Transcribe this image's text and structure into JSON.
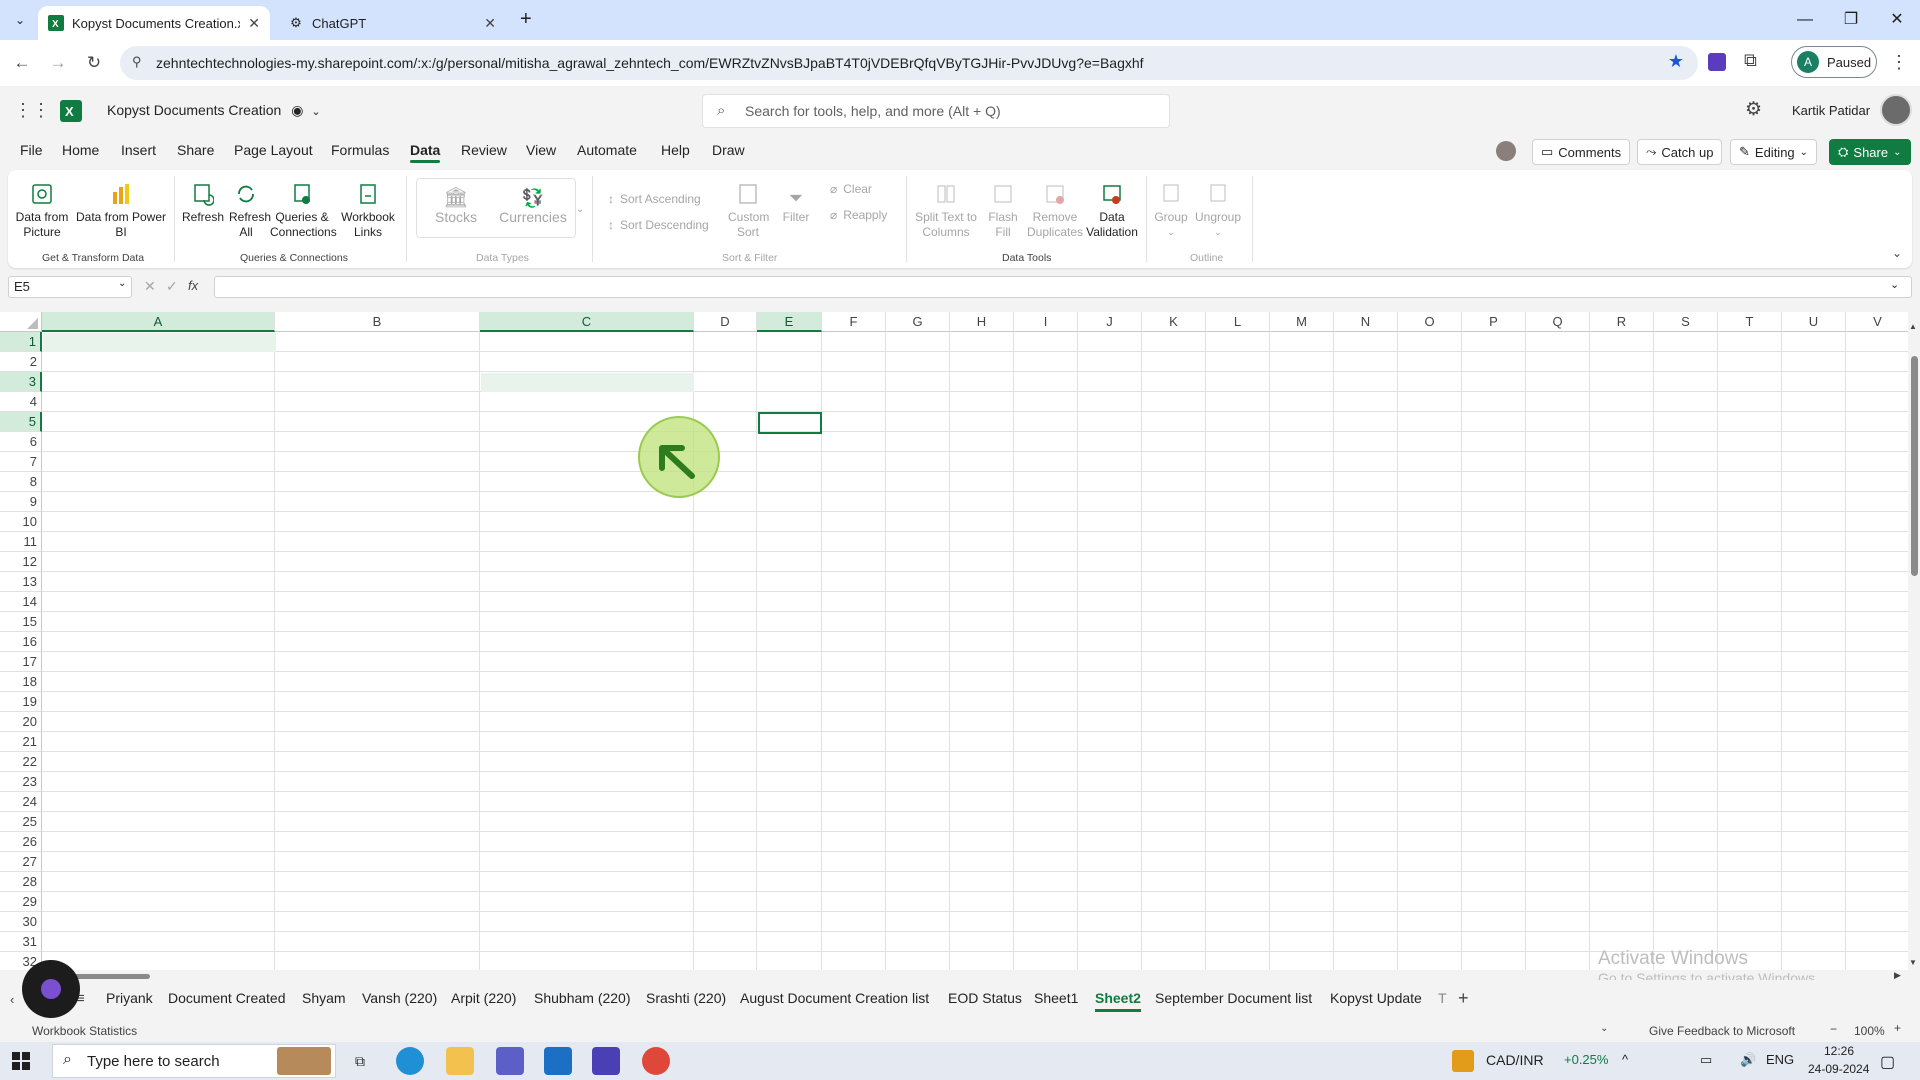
{
  "browser": {
    "tabs": [
      {
        "title": "Kopyst Documents Creation.xlsx",
        "active": true
      },
      {
        "title": "ChatGPT",
        "active": false
      }
    ],
    "url": "zehntechtechnologies-my.sharepoint.com/:x:/g/personal/mitisha_agrawal_zehntech_com/EWRZtvZNvsBJpaBT4T0jVDEBrQfqVByTGJHir-PvvJDUvg?e=Bagxhf",
    "profile_initial": "A",
    "profile_status": "Paused"
  },
  "app": {
    "title": "Kopyst Documents Creation",
    "search_placeholder": "Search for tools, help, and more (Alt + Q)",
    "user_name": "Kartik Patidar"
  },
  "menu": {
    "items": [
      "File",
      "Home",
      "Insert",
      "Share",
      "Page Layout",
      "Formulas",
      "Data",
      "Review",
      "View",
      "Automate",
      "Help",
      "Draw"
    ],
    "selected": "Data",
    "comments": "Comments",
    "catchup": "Catch up",
    "editing": "Editing",
    "share": "Share"
  },
  "ribbon": {
    "data_from_picture": "Data from Picture",
    "data_from_powerbi": "Data from Power BI",
    "refresh": "Refresh",
    "refresh_all": "Refresh All",
    "queries": "Queries & Connections",
    "workbook_links": "Workbook Links",
    "stocks": "Stocks",
    "currencies": "Currencies",
    "sort_asc": "Sort Ascending",
    "sort_desc": "Sort Descending",
    "custom_sort": "Custom Sort",
    "filter": "Filter",
    "clear": "Clear",
    "reapply": "Reapply",
    "split_text": "Split Text to Columns",
    "flash_fill": "Flash Fill",
    "remove_dupes": "Remove Duplicates",
    "data_validation": "Data Validation",
    "group": "Group",
    "ungroup": "Ungroup",
    "groups": {
      "get_transform": "Get & Transform Data",
      "queries_connections": "Queries & Connections",
      "data_types": "Data Types",
      "sort_filter": "Sort & Filter",
      "data_tools": "Data Tools",
      "outline": "Outline"
    }
  },
  "formula_bar": {
    "name_box": "E5",
    "formula": ""
  },
  "grid": {
    "columns": [
      "A",
      "B",
      "C",
      "D",
      "E",
      "F",
      "G",
      "H",
      "I",
      "J",
      "K",
      "L",
      "M",
      "N",
      "O",
      "P",
      "Q",
      "R",
      "S",
      "T",
      "U",
      "V"
    ],
    "rows": [
      "1",
      "2",
      "3",
      "4",
      "5",
      "6",
      "7",
      "8",
      "9",
      "10",
      "11",
      "12",
      "13",
      "14",
      "15",
      "16",
      "17",
      "18",
      "19",
      "20",
      "21",
      "22",
      "23",
      "24",
      "25",
      "26",
      "27",
      "28",
      "29",
      "30",
      "31",
      "32"
    ],
    "active_cell": "E5",
    "highlighted_rows": [
      "1",
      "3",
      "5"
    ],
    "highlighted_columns": [
      "A",
      "C",
      "E"
    ]
  },
  "sheets": {
    "tabs": [
      "Priyank",
      "Document Created",
      "Shyam",
      "Vansh (220)",
      "Arpit (220)",
      "Shubham (220)",
      "Srashti (220)",
      "August Document Creation list",
      "EOD Status",
      "Sheet1",
      "Sheet2",
      "September Document list",
      "Kopyst Update",
      "T"
    ],
    "active": "Sheet2"
  },
  "status": {
    "left": "Workbook Statistics",
    "feedback": "Give Feedback to Microsoft",
    "zoom": "100%"
  },
  "watermark": {
    "line1": "Activate Windows",
    "line2": "Go to Settings to activate Windows."
  },
  "taskbar": {
    "search_placeholder": "Type here to search",
    "ticker": "CAD/INR",
    "ticker_change": "+0.25%",
    "lang": "ENG",
    "time": "12:26",
    "date": "24-09-2024"
  }
}
